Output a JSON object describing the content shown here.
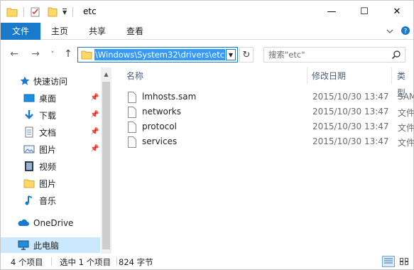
{
  "window": {
    "title": "etc",
    "controls": {
      "minimize": "—",
      "maximize": "☐",
      "close": "✕"
    }
  },
  "ribbon": {
    "tabs": [
      {
        "label": "文件",
        "active": true
      },
      {
        "label": "主页"
      },
      {
        "label": "共享"
      },
      {
        "label": "查看"
      }
    ],
    "expand_icon": "chevron-down-icon",
    "help_icon": "help-icon"
  },
  "navigation": {
    "back_icon": "←",
    "forward_icon": "→",
    "recent_icon": "˅",
    "up_icon": "↑",
    "address": "\\Windows\\System32\\drivers\\etc",
    "search_placeholder": "搜索\"etc\""
  },
  "nav_pane": {
    "items": [
      {
        "label": "快速访问",
        "icon": "star-icon"
      },
      {
        "label": "桌面",
        "icon": "desktop-icon",
        "pinned": true
      },
      {
        "label": "下载",
        "icon": "download-icon",
        "pinned": true
      },
      {
        "label": "文档",
        "icon": "document-icon",
        "pinned": true
      },
      {
        "label": "图片",
        "icon": "picture-icon",
        "pinned": true
      },
      {
        "label": "视频",
        "icon": "video-icon"
      },
      {
        "label": "图片",
        "icon": "folder-icon"
      },
      {
        "label": "音乐",
        "icon": "music-icon"
      },
      {
        "label": "OneDrive",
        "icon": "cloud-icon"
      },
      {
        "label": "此电脑",
        "icon": "computer-icon",
        "selected": true
      }
    ]
  },
  "file_list": {
    "columns": [
      "名称",
      "修改日期",
      "类型"
    ],
    "rows": [
      {
        "name": "lmhosts.sam",
        "date": "2015/10/30 13:47",
        "type": "SAM"
      },
      {
        "name": "networks",
        "date": "2015/10/30 13:47",
        "type": "文件"
      },
      {
        "name": "protocol",
        "date": "2015/10/30 13:47",
        "type": "文件"
      },
      {
        "name": "services",
        "date": "2015/10/30 13:47",
        "type": "文件"
      }
    ]
  },
  "status": {
    "count": "4 个项目",
    "selection": "选中 1 个项目",
    "size": "824 字节"
  },
  "colors": {
    "accent": "#1979ca",
    "selection": "#3399ff",
    "folder": "#ffd867"
  }
}
